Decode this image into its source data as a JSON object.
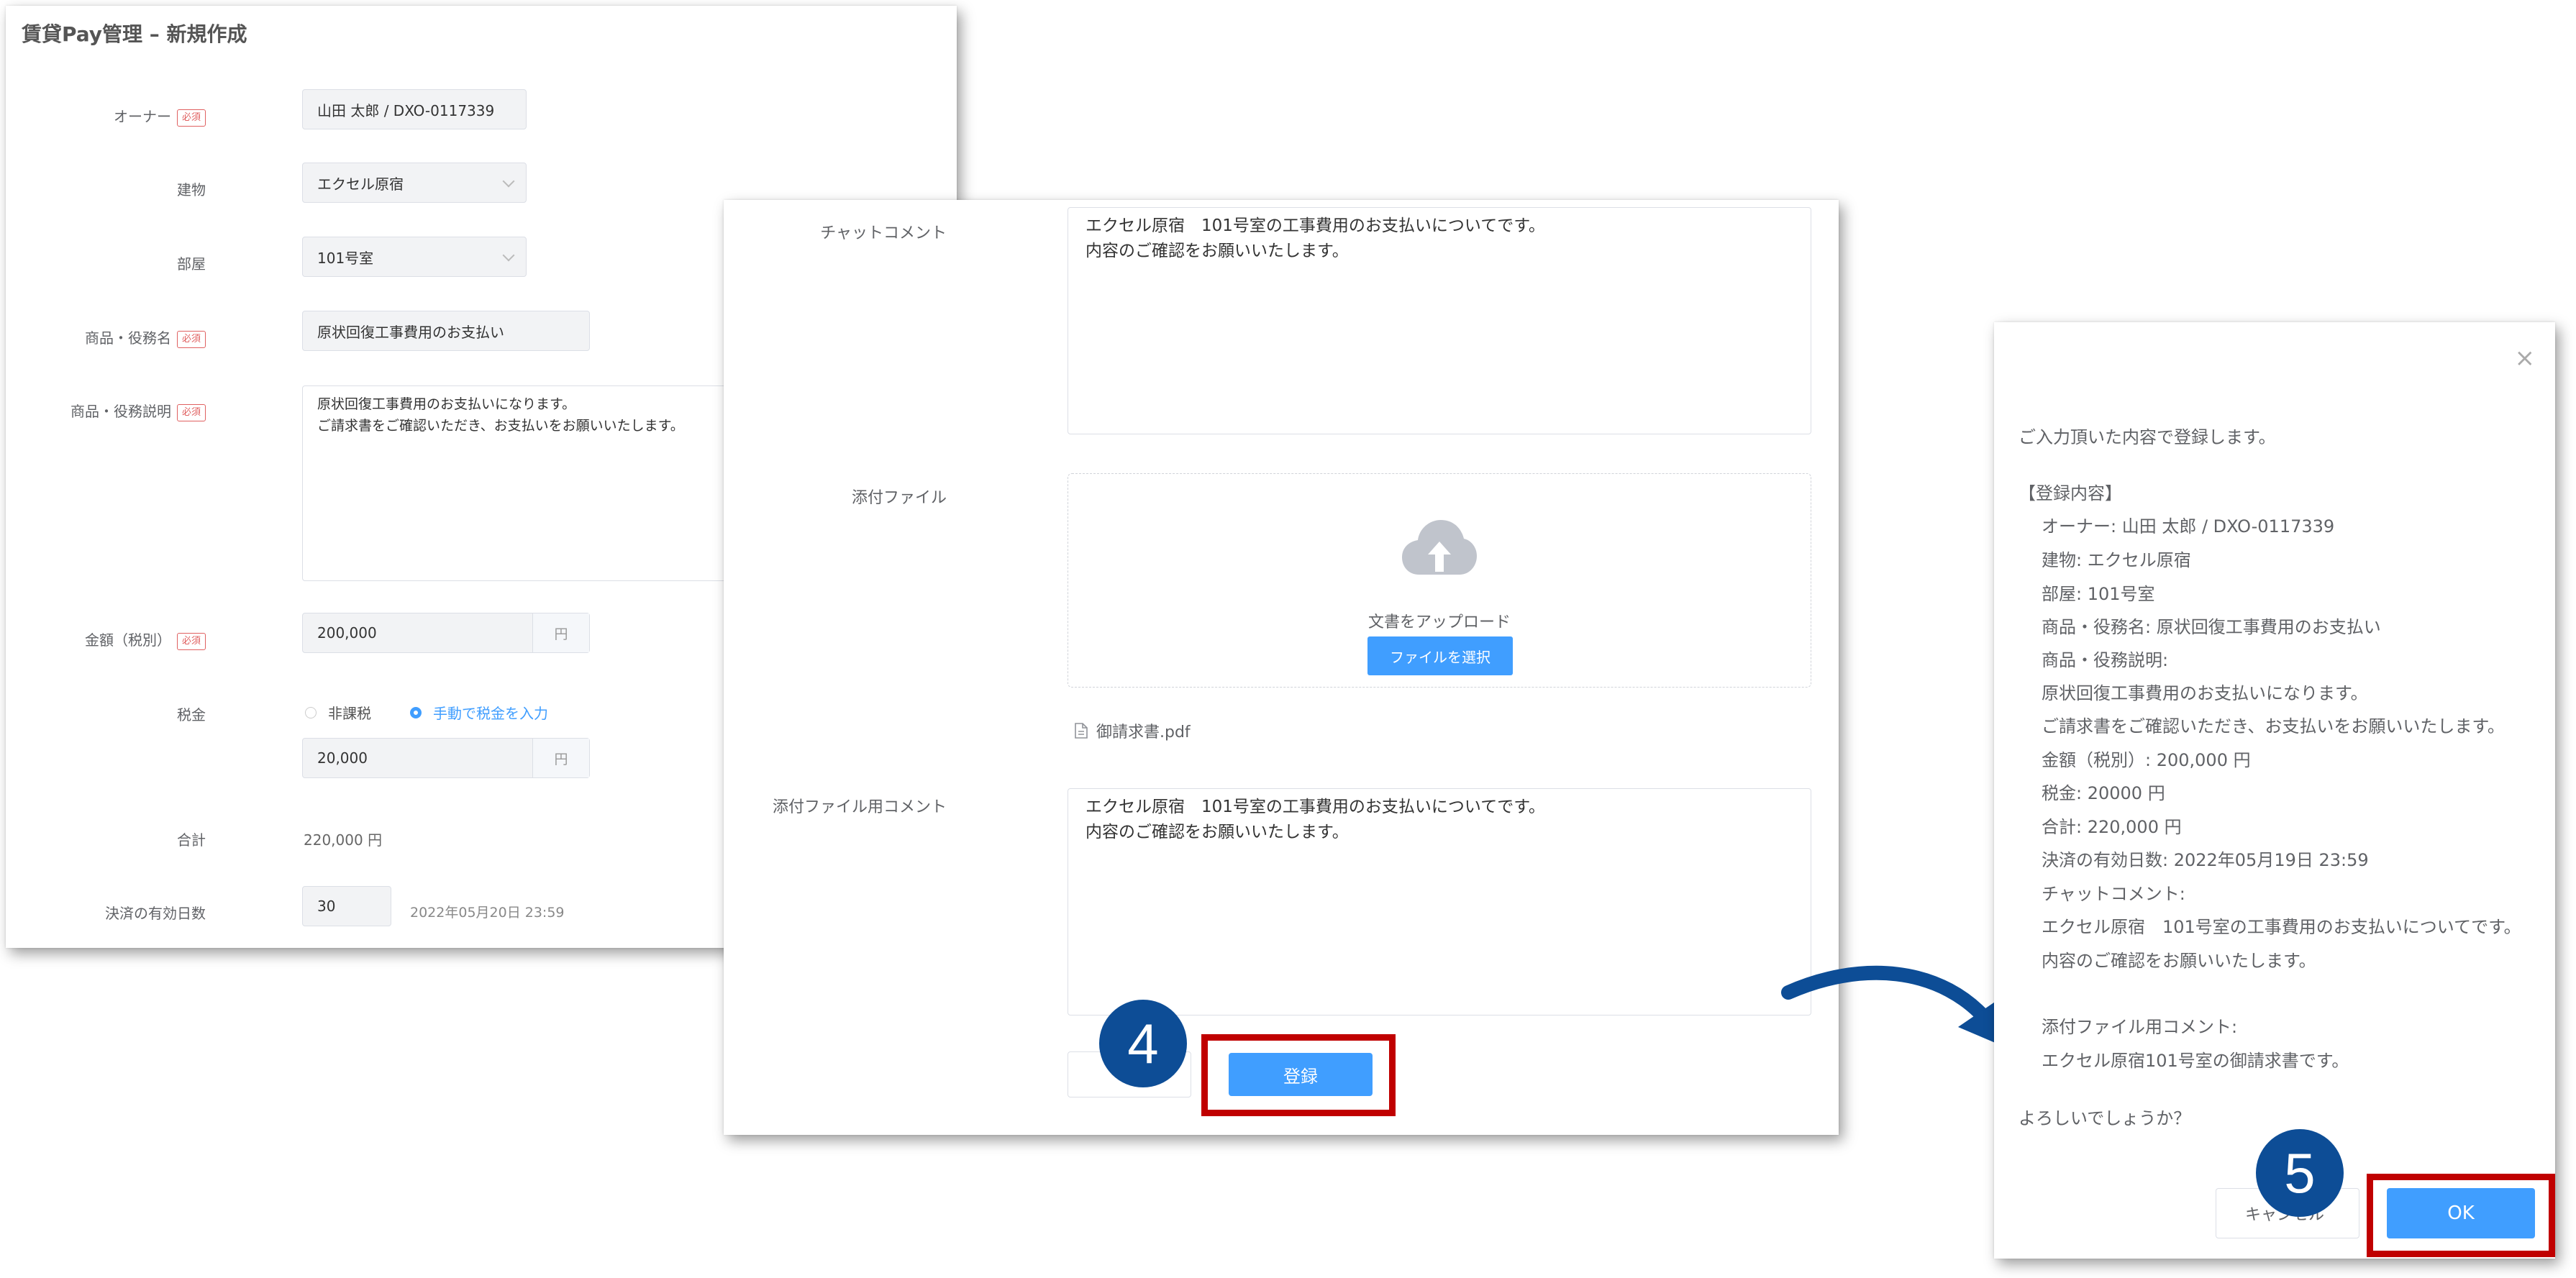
{
  "form": {
    "title": "賃貸Pay管理 – 新規作成",
    "required_badge": "必須",
    "owner": {
      "label": "オーナー",
      "value": "山田 太郎 / DXO-0117339"
    },
    "building": {
      "label": "建物",
      "value": "エクセル原宿"
    },
    "room": {
      "label": "部屋",
      "value": "101号室"
    },
    "product_name": {
      "label": "商品・役務名",
      "value": "原状回復工事費用のお支払い"
    },
    "product_desc": {
      "label": "商品・役務説明",
      "line1": "原状回復工事費用のお支払いになります。",
      "line2": "ご請求書をご確認いただき、お支払いをお願いいたします。"
    },
    "amount": {
      "label": "金額（税別）",
      "value": "200,000",
      "unit": "円"
    },
    "tax": {
      "label": "税金",
      "option_exempt": "非課税",
      "option_manual": "手動で税金を入力",
      "selected": "option_manual",
      "value": "20,000",
      "unit": "円"
    },
    "total": {
      "label": "合計",
      "value": "220,000  円"
    },
    "validity": {
      "label": "決済の有効日数",
      "days": "30",
      "deadline": "2022年05月20日 23:59"
    }
  },
  "comments": {
    "chat_label": "チャットコメント",
    "chat_line1": "エクセル原宿　101号室の工事費用のお支払いについてです。",
    "chat_line2": "内容のご確認をお願いいたします。",
    "attach_label": "添付ファイル",
    "upload_text": "文書をアップロード",
    "choose_file": "ファイルを選択",
    "file_name": "御請求書.pdf",
    "attach_comment_label": "添付ファイル用コメント",
    "attach_line1": "エクセル原宿　101号室の工事費用のお支払いについてです。",
    "attach_line2": "内容のご確認をお願いいたします。",
    "register_button": "登録",
    "step": "4"
  },
  "dialog": {
    "close": "×",
    "intro": "ご入力頂いた内容で登録します。",
    "heading": "【登録内容】",
    "lines": [
      "オーナー: 山田 太郎 / DXO-0117339",
      "建物: エクセル原宿",
      "部屋: 101号室",
      "商品・役務名: 原状回復工事費用のお支払い",
      "商品・役務説明:",
      "原状回復工事費用のお支払いになります。",
      "ご請求書をご確認いただき、お支払いをお願いいたします。",
      "金額（税別）: 200,000 円",
      "税金: 20000 円",
      "合計: 220,000 円",
      "決済の有効日数: 2022年05月19日 23:59",
      "チャットコメント:",
      "エクセル原宿　101号室の工事費用のお支払いについてです。",
      "内容のご確認をお願いいたします。"
    ],
    "attach_comment_label": "添付ファイル用コメント:",
    "attach_comment": "エクセル原宿101号室の御請求書です。",
    "question": "よろしいでしょうか？",
    "cancel_button": "キャンセル",
    "ok_button": "OK",
    "step": "5"
  },
  "colors": {
    "primary": "#409eff",
    "highlight": "#c00000",
    "step_circle": "#0d4d96"
  }
}
